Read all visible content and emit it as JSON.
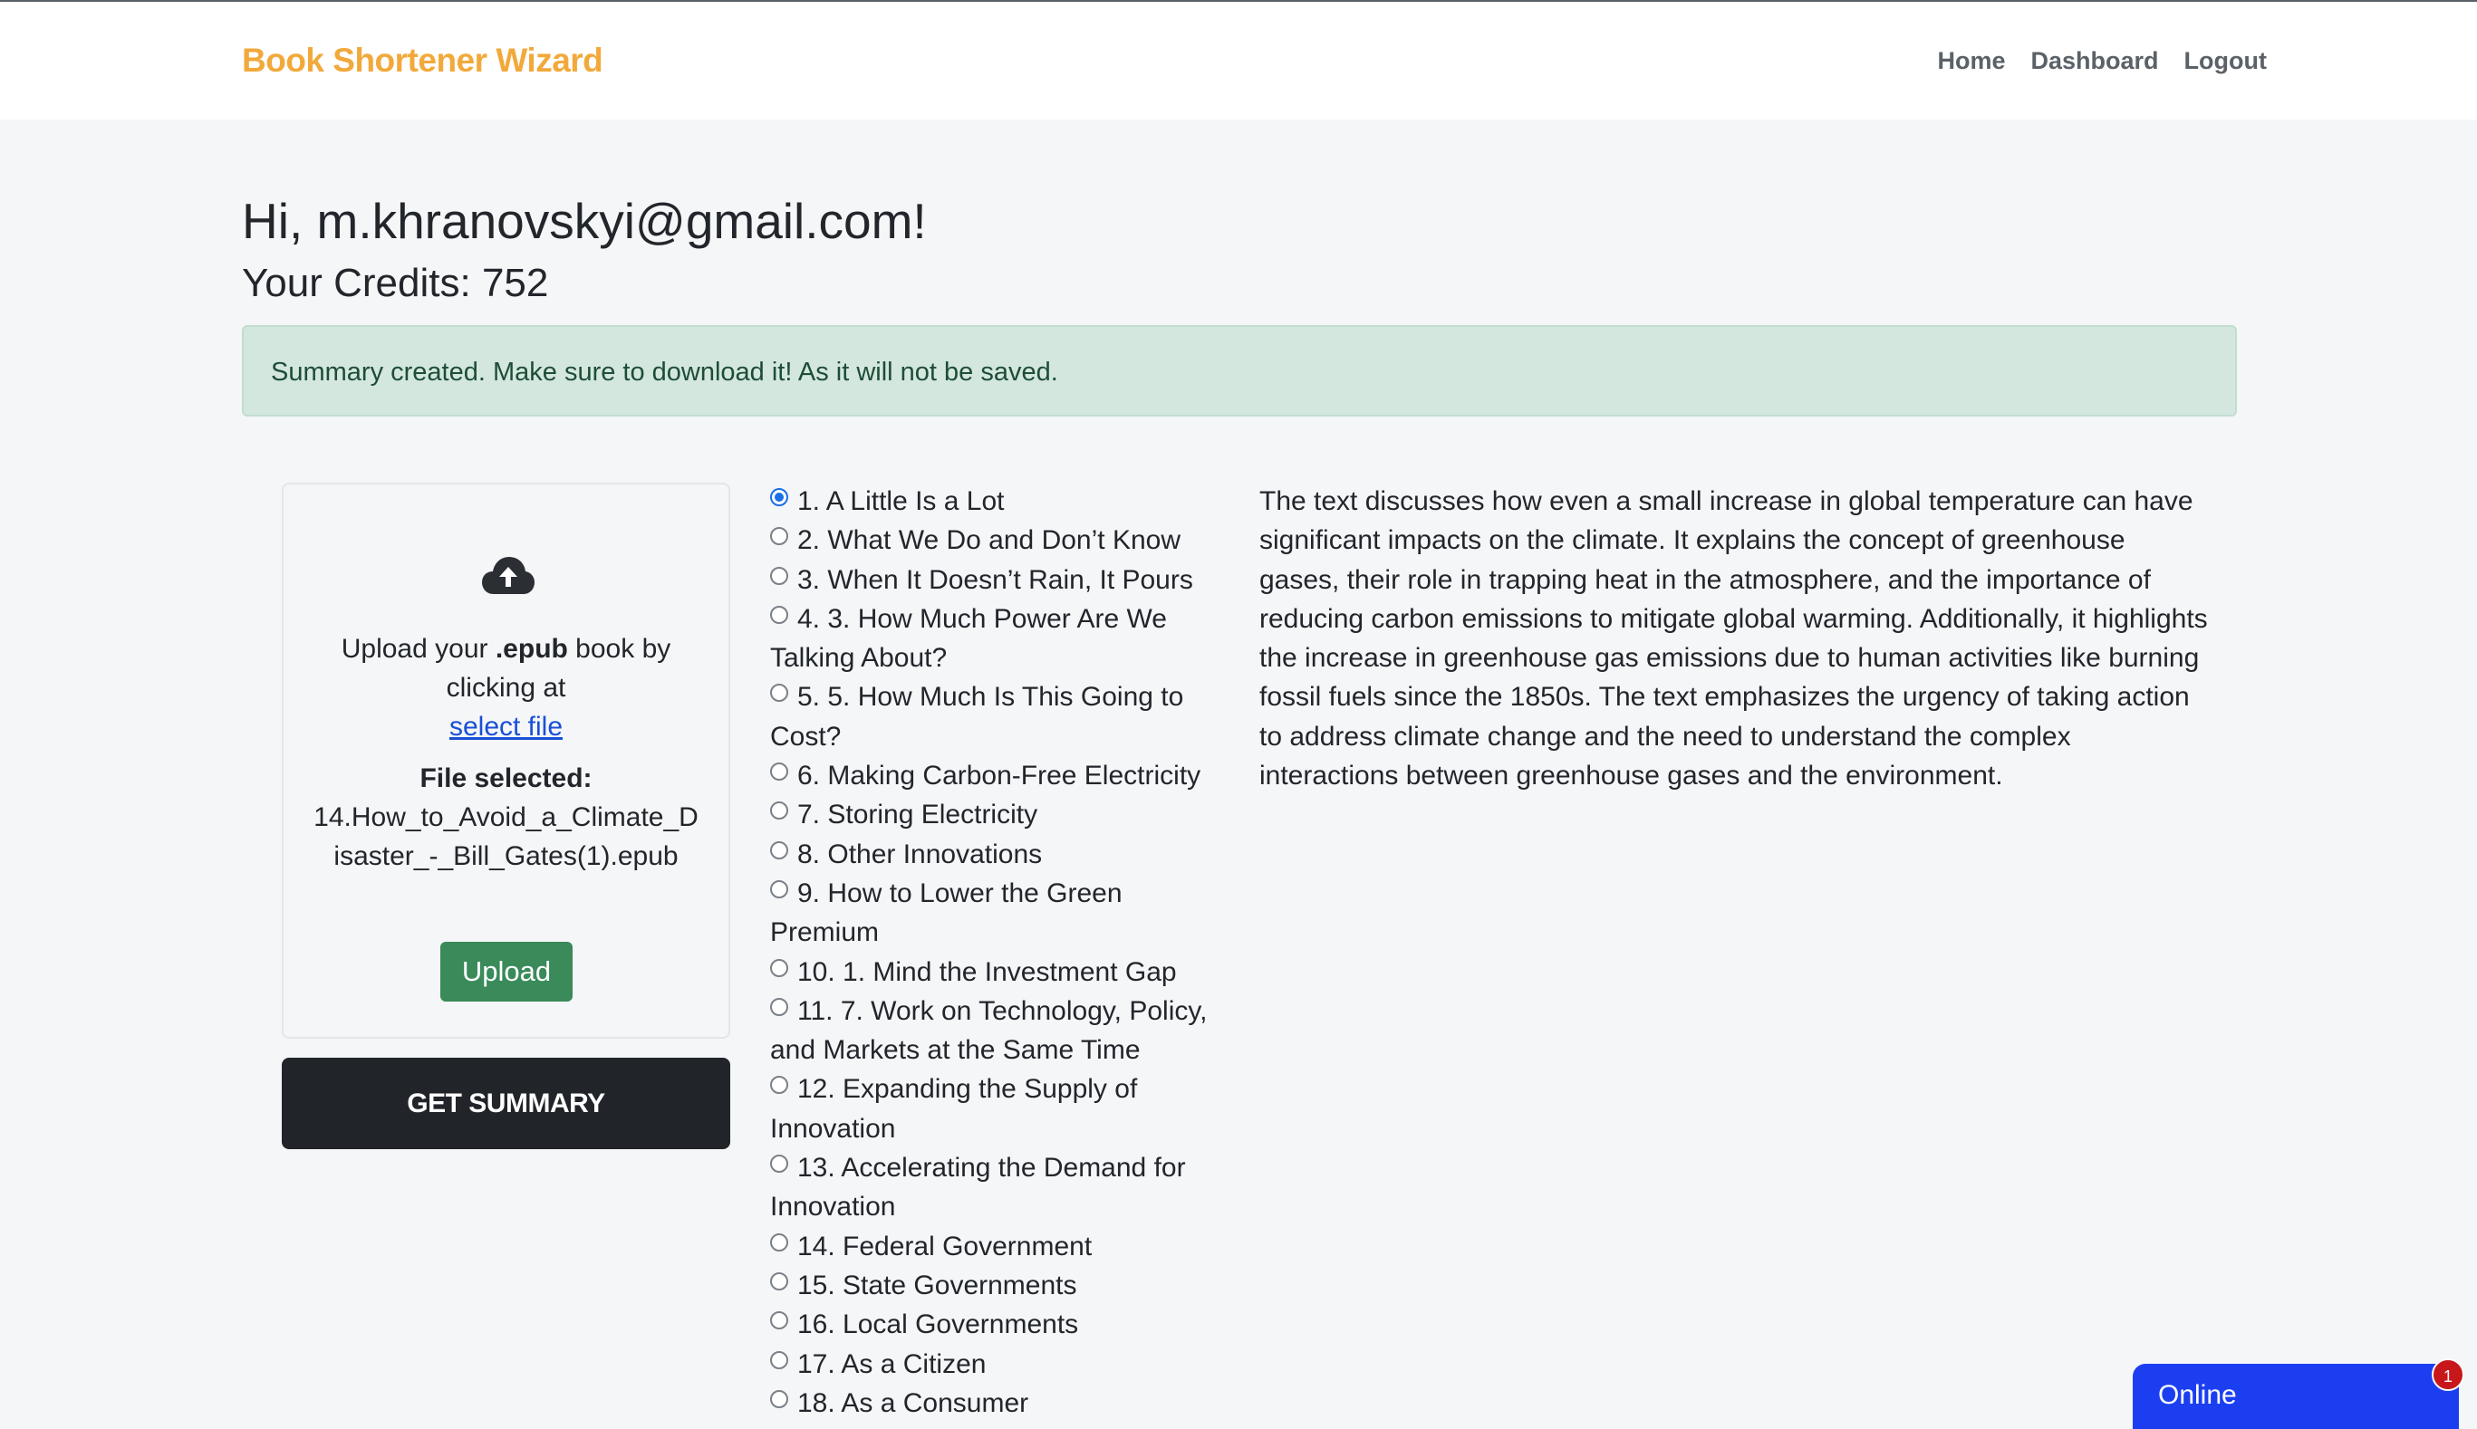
{
  "navbar": {
    "brand": "Book Shortener Wizard",
    "links": [
      "Home",
      "Dashboard",
      "Logout"
    ]
  },
  "greeting": "Hi, m.khranovskyi@gmail.com!",
  "credits": "Your Credits: 752",
  "alert": "Summary created. Make sure to download it! As it will not be saved.",
  "upload": {
    "icon": "cloud-upload-icon",
    "text_prefix": "Upload your ",
    "text_ext": ".epub",
    "text_suffix": " book by clicking at",
    "link_text": "select file",
    "file_label": "File selected:",
    "file_name": "14.How_to_Avoid_a_Climate_Disaster_-_Bill_Gates(1).epub",
    "upload_button": "Upload"
  },
  "get_summary_button": "GET SUMMARY",
  "chapters": [
    {
      "label": "1. A Little Is a Lot",
      "selected": true
    },
    {
      "label": "2. What We Do and Don’t Know",
      "selected": false
    },
    {
      "label": "3. When It Doesn’t Rain, It Pours",
      "selected": false
    },
    {
      "label": "4. 3. How Much Power Are We Talking About?",
      "selected": false
    },
    {
      "label": "5. 5. How Much Is This Going to Cost?",
      "selected": false
    },
    {
      "label": "6. Making Carbon-Free Electricity",
      "selected": false
    },
    {
      "label": "7. Storing Electricity",
      "selected": false
    },
    {
      "label": "8. Other Innovations",
      "selected": false
    },
    {
      "label": "9. How to Lower the Green Premium",
      "selected": false
    },
    {
      "label": "10. 1. Mind the Investment Gap",
      "selected": false
    },
    {
      "label": "11. 7. Work on Technology, Policy, and Markets at the Same Time",
      "selected": false
    },
    {
      "label": "12. Expanding the Supply of Innovation",
      "selected": false
    },
    {
      "label": "13. Accelerating the Demand for Innovation",
      "selected": false
    },
    {
      "label": "14. Federal Government",
      "selected": false
    },
    {
      "label": "15. State Governments",
      "selected": false
    },
    {
      "label": "16. Local Governments",
      "selected": false
    },
    {
      "label": "17. As a Citizen",
      "selected": false
    },
    {
      "label": "18. As a Consumer",
      "selected": false
    }
  ],
  "summary": "The text discusses how even a small increase in global temperature can have significant impacts on the climate. It explains the concept of greenhouse gases, their role in trapping heat in the atmosphere, and the importance of reducing carbon emissions to mitigate global warming. Additionally, it highlights the increase in greenhouse gas emissions due to human activities like burning fossil fuels since the 1850s. The text emphasizes the urgency of taking action to address climate change and the need to understand the complex interactions between greenhouse gases and the environment.",
  "chat_widget": {
    "label": "Online",
    "badge": "1"
  },
  "colors": {
    "brand": "#f2a93b",
    "alert_bg": "#d3e7df",
    "upload_button": "#3a8a5a",
    "summary_button": "#212529",
    "link": "#1a4fd6",
    "chat_widget": "#1b3ff0",
    "badge": "#c8171b"
  }
}
